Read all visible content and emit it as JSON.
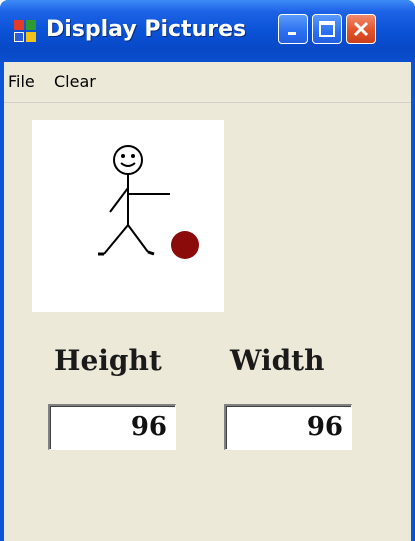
{
  "window": {
    "title": "Display Pictures",
    "icon": "app-window-icon",
    "controls": {
      "minimize_icon": "minimize-icon",
      "maximize_icon": "maximize-icon",
      "close_icon": "close-icon"
    }
  },
  "menu": {
    "file": "File",
    "clear": "Clear"
  },
  "picture": {
    "description_icon": "stick-figure-with-ball-image",
    "ball_color": "#8b0a0a"
  },
  "dimensions": {
    "height_label": "Height",
    "height_value": "96",
    "width_label": "Width",
    "width_value": "96"
  },
  "colors": {
    "titlebar": "#0a52d6",
    "client_background": "#ece9d8",
    "close_button": "#e2532a"
  }
}
